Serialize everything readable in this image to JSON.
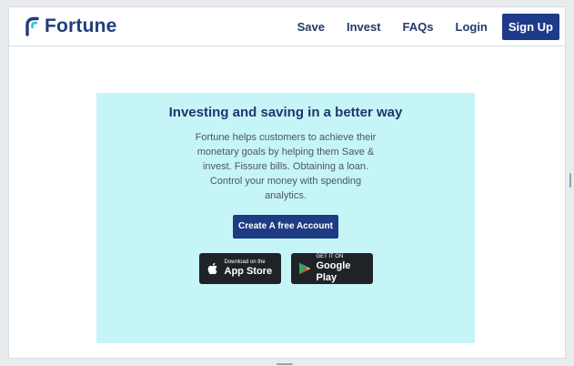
{
  "brand": {
    "name": "Fortune",
    "color": "#1f3d7a",
    "logo_icon": "fortune-logo-icon"
  },
  "nav": {
    "items": [
      {
        "label": "Save"
      },
      {
        "label": "Invest"
      },
      {
        "label": "FAQs"
      },
      {
        "label": "Login"
      }
    ],
    "signup_label": "Sign Up",
    "signup_color": "#1e3a8a"
  },
  "hero": {
    "background": "#c6f5f8",
    "title": "Investing and saving in a better way",
    "description": "Fortune helps customers to achieve their monetary goals by helping them Save & invest. Fissure bills. Obtaining a loan. Control your money with spending analytics.",
    "cta_label": "Create A free Account",
    "stores": {
      "app_store": {
        "small": "Download on the",
        "big": "App Store",
        "icon": "apple-icon"
      },
      "google_play": {
        "small": "GET IT ON",
        "big": "Google Play",
        "icon": "google-play-icon"
      }
    }
  }
}
